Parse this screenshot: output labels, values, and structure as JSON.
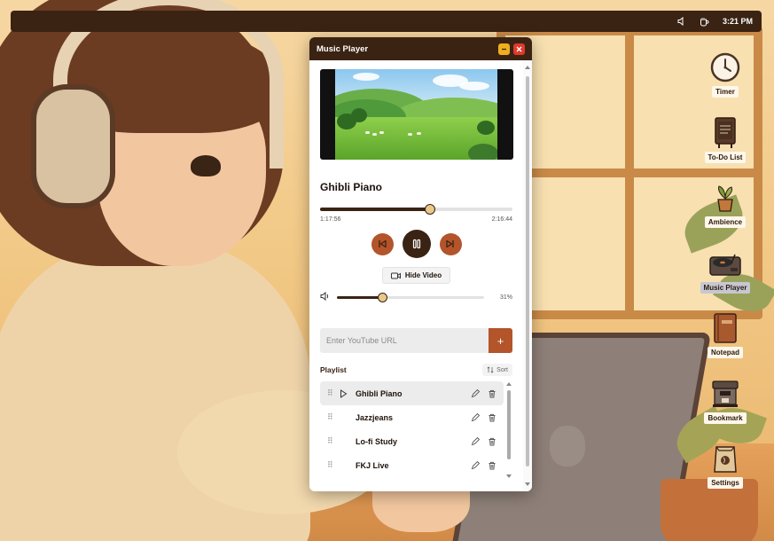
{
  "top_bar": {
    "icons": [
      "speaker-icon",
      "coffee-cup-icon"
    ],
    "time": "3:21 PM"
  },
  "desktop": {
    "icons": [
      {
        "label": "Timer",
        "icon": "clock-icon"
      },
      {
        "label": "To-Do List",
        "icon": "menu-board-icon"
      },
      {
        "label": "Ambience",
        "icon": "potted-plant-icon"
      },
      {
        "label": "Music Player",
        "icon": "turntable-icon",
        "active": true
      },
      {
        "label": "Notepad",
        "icon": "notebook-icon"
      },
      {
        "label": "Bookmark",
        "icon": "espresso-machine-icon"
      },
      {
        "label": "Settings",
        "icon": "coffee-bag-icon"
      }
    ]
  },
  "player": {
    "title": "Music Player",
    "track_title": "Ghibli Piano",
    "elapsed": "1:17:56",
    "duration": "2:16:44",
    "progress_fraction": 0.57,
    "hide_video_label": "Hide Video",
    "volume_percent_label": "31%",
    "volume_fraction": 0.31,
    "url_placeholder": "Enter YouTube URL",
    "add_label": "+",
    "playlist_title": "Playlist",
    "sort_label": "Sort",
    "playlist": [
      {
        "name": "Ghibli Piano",
        "current": true
      },
      {
        "name": "Jazzjeans",
        "current": false
      },
      {
        "name": "Lo-fi Study",
        "current": false
      },
      {
        "name": "FKJ Live",
        "current": false
      }
    ]
  },
  "colors": {
    "accent": "#b3542a",
    "dark": "#3a2313",
    "knob": "#e9c98a"
  }
}
